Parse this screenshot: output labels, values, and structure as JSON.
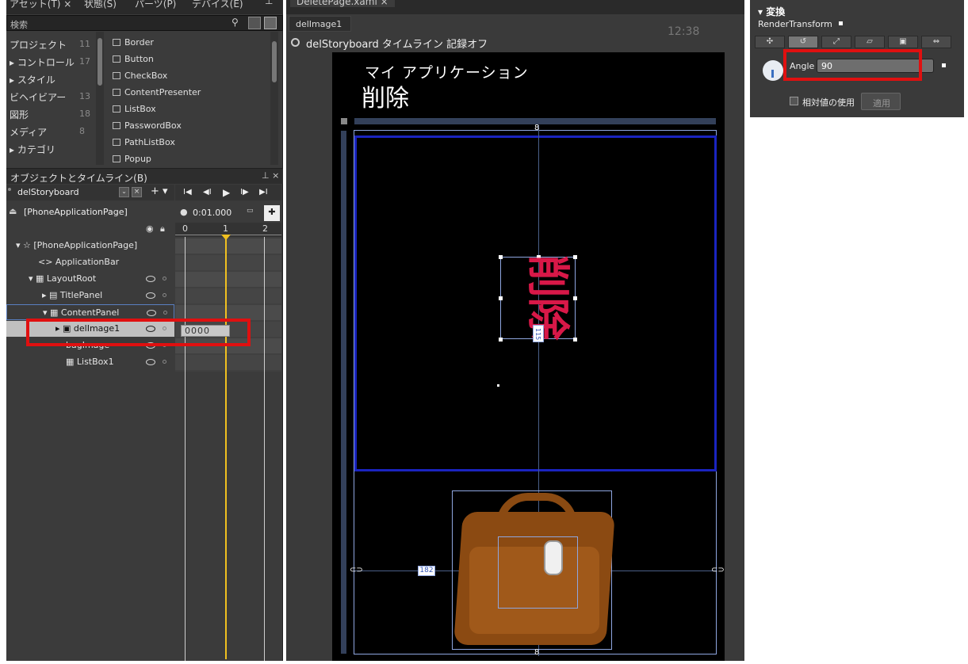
{
  "tabs": {
    "assets": "アセット(T) ×",
    "states": "状態(S)",
    "parts": "パーツ(P)",
    "devices": "デバイス(E)",
    "doc": "DeletePage.xaml ×"
  },
  "search": {
    "label": "検索"
  },
  "categories": [
    {
      "label": "プロジェクト",
      "count": "11"
    },
    {
      "label": "▸ コントロール",
      "count": "17"
    },
    {
      "label": "▸ スタイル",
      "count": ""
    },
    {
      "label": "ビヘイビアー",
      "count": "13"
    },
    {
      "label": "図形",
      "count": "18"
    },
    {
      "label": "メディア",
      "count": "8"
    },
    {
      "label": "▸ カテゴリ",
      "count": ""
    }
  ],
  "components": [
    "Border",
    "Button",
    "CheckBox",
    "ContentPresenter",
    "ListBox",
    "PasswordBox",
    "PathListBox",
    "Popup"
  ],
  "objects_panel": {
    "title": "オブジェクトとタイムライン(B)",
    "storyboard": "delStoryboard",
    "scope": "[PhoneApplicationPage]",
    "time": "0:01.000",
    "ticks": [
      "0",
      "1",
      "2"
    ]
  },
  "tree": [
    {
      "label": "▾ ☆ [PhoneApplicationPage]"
    },
    {
      "label": "<> ApplicationBar"
    },
    {
      "label": "▾ ▦ LayoutRoot"
    },
    {
      "label": "▸ ▤ TitlePanel"
    },
    {
      "label": "▾ ▦ ContentPanel"
    },
    {
      "label": "▸ ▣ delImage1"
    },
    {
      "label": "bagImage"
    },
    {
      "label": "▦ ListBox1"
    }
  ],
  "keyframe": "0000",
  "breadcrumb": "delImage1",
  "timeline_status": "delStoryboard タイムライン 記録オフ",
  "phone": {
    "app_title": "マイ アプリケーション",
    "page_title": "削除",
    "clock": "12:38",
    "width_label": "182",
    "height_label": "115"
  },
  "props": {
    "section": "変換",
    "transform": "RenderTransform",
    "angle_label": "Angle",
    "angle_value": "90",
    "relative": "相対値の使用",
    "apply": "適用"
  },
  "colors": {
    "accent_red": "#e01010",
    "blue_border": "#1a24c0",
    "playhead": "#f0c020"
  }
}
